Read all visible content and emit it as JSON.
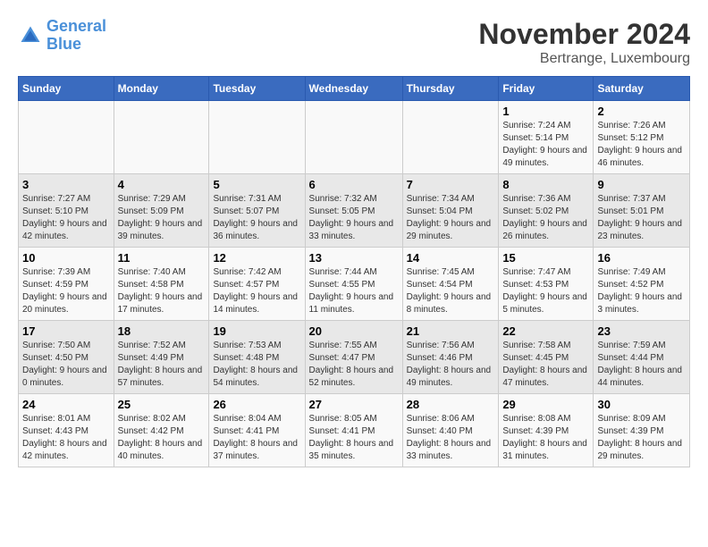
{
  "header": {
    "logo_line1": "General",
    "logo_line2": "Blue",
    "month": "November 2024",
    "location": "Bertrange, Luxembourg"
  },
  "days_of_week": [
    "Sunday",
    "Monday",
    "Tuesday",
    "Wednesday",
    "Thursday",
    "Friday",
    "Saturday"
  ],
  "weeks": [
    [
      {
        "day": "",
        "info": ""
      },
      {
        "day": "",
        "info": ""
      },
      {
        "day": "",
        "info": ""
      },
      {
        "day": "",
        "info": ""
      },
      {
        "day": "",
        "info": ""
      },
      {
        "day": "1",
        "info": "Sunrise: 7:24 AM\nSunset: 5:14 PM\nDaylight: 9 hours and 49 minutes."
      },
      {
        "day": "2",
        "info": "Sunrise: 7:26 AM\nSunset: 5:12 PM\nDaylight: 9 hours and 46 minutes."
      }
    ],
    [
      {
        "day": "3",
        "info": "Sunrise: 7:27 AM\nSunset: 5:10 PM\nDaylight: 9 hours and 42 minutes."
      },
      {
        "day": "4",
        "info": "Sunrise: 7:29 AM\nSunset: 5:09 PM\nDaylight: 9 hours and 39 minutes."
      },
      {
        "day": "5",
        "info": "Sunrise: 7:31 AM\nSunset: 5:07 PM\nDaylight: 9 hours and 36 minutes."
      },
      {
        "day": "6",
        "info": "Sunrise: 7:32 AM\nSunset: 5:05 PM\nDaylight: 9 hours and 33 minutes."
      },
      {
        "day": "7",
        "info": "Sunrise: 7:34 AM\nSunset: 5:04 PM\nDaylight: 9 hours and 29 minutes."
      },
      {
        "day": "8",
        "info": "Sunrise: 7:36 AM\nSunset: 5:02 PM\nDaylight: 9 hours and 26 minutes."
      },
      {
        "day": "9",
        "info": "Sunrise: 7:37 AM\nSunset: 5:01 PM\nDaylight: 9 hours and 23 minutes."
      }
    ],
    [
      {
        "day": "10",
        "info": "Sunrise: 7:39 AM\nSunset: 4:59 PM\nDaylight: 9 hours and 20 minutes."
      },
      {
        "day": "11",
        "info": "Sunrise: 7:40 AM\nSunset: 4:58 PM\nDaylight: 9 hours and 17 minutes."
      },
      {
        "day": "12",
        "info": "Sunrise: 7:42 AM\nSunset: 4:57 PM\nDaylight: 9 hours and 14 minutes."
      },
      {
        "day": "13",
        "info": "Sunrise: 7:44 AM\nSunset: 4:55 PM\nDaylight: 9 hours and 11 minutes."
      },
      {
        "day": "14",
        "info": "Sunrise: 7:45 AM\nSunset: 4:54 PM\nDaylight: 9 hours and 8 minutes."
      },
      {
        "day": "15",
        "info": "Sunrise: 7:47 AM\nSunset: 4:53 PM\nDaylight: 9 hours and 5 minutes."
      },
      {
        "day": "16",
        "info": "Sunrise: 7:49 AM\nSunset: 4:52 PM\nDaylight: 9 hours and 3 minutes."
      }
    ],
    [
      {
        "day": "17",
        "info": "Sunrise: 7:50 AM\nSunset: 4:50 PM\nDaylight: 9 hours and 0 minutes."
      },
      {
        "day": "18",
        "info": "Sunrise: 7:52 AM\nSunset: 4:49 PM\nDaylight: 8 hours and 57 minutes."
      },
      {
        "day": "19",
        "info": "Sunrise: 7:53 AM\nSunset: 4:48 PM\nDaylight: 8 hours and 54 minutes."
      },
      {
        "day": "20",
        "info": "Sunrise: 7:55 AM\nSunset: 4:47 PM\nDaylight: 8 hours and 52 minutes."
      },
      {
        "day": "21",
        "info": "Sunrise: 7:56 AM\nSunset: 4:46 PM\nDaylight: 8 hours and 49 minutes."
      },
      {
        "day": "22",
        "info": "Sunrise: 7:58 AM\nSunset: 4:45 PM\nDaylight: 8 hours and 47 minutes."
      },
      {
        "day": "23",
        "info": "Sunrise: 7:59 AM\nSunset: 4:44 PM\nDaylight: 8 hours and 44 minutes."
      }
    ],
    [
      {
        "day": "24",
        "info": "Sunrise: 8:01 AM\nSunset: 4:43 PM\nDaylight: 8 hours and 42 minutes."
      },
      {
        "day": "25",
        "info": "Sunrise: 8:02 AM\nSunset: 4:42 PM\nDaylight: 8 hours and 40 minutes."
      },
      {
        "day": "26",
        "info": "Sunrise: 8:04 AM\nSunset: 4:41 PM\nDaylight: 8 hours and 37 minutes."
      },
      {
        "day": "27",
        "info": "Sunrise: 8:05 AM\nSunset: 4:41 PM\nDaylight: 8 hours and 35 minutes."
      },
      {
        "day": "28",
        "info": "Sunrise: 8:06 AM\nSunset: 4:40 PM\nDaylight: 8 hours and 33 minutes."
      },
      {
        "day": "29",
        "info": "Sunrise: 8:08 AM\nSunset: 4:39 PM\nDaylight: 8 hours and 31 minutes."
      },
      {
        "day": "30",
        "info": "Sunrise: 8:09 AM\nSunset: 4:39 PM\nDaylight: 8 hours and 29 minutes."
      }
    ]
  ]
}
